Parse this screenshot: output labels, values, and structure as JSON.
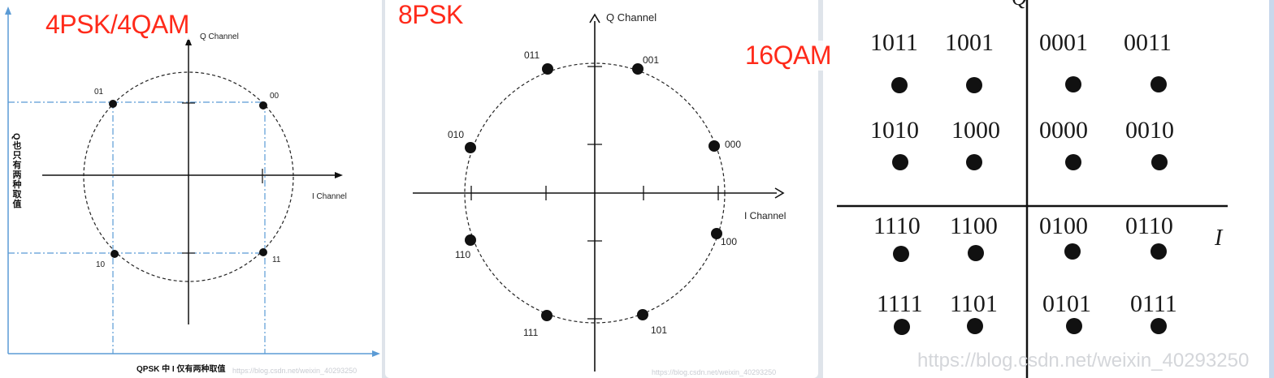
{
  "panels": {
    "qpsk": {
      "title": "4PSK/4QAM",
      "q_axis": "Q Channel",
      "i_axis": "I Channel",
      "left_note": "Q也只有两种取值",
      "bottom_note": "QPSK 中 I 仅有两种取值",
      "watermark": "https://blog.csdn.net/weixin_40293250",
      "points": [
        "01",
        "00",
        "10",
        "11"
      ]
    },
    "psk8": {
      "title": "8PSK",
      "q_axis": "Q Channel",
      "i_axis": "I Channel",
      "watermark": "https://blog.csdn.net/weixin_40293250",
      "points": [
        "000",
        "001",
        "011",
        "010",
        "110",
        "111",
        "101",
        "100"
      ]
    },
    "qam16": {
      "title": "16QAM",
      "i_label": "I",
      "q_label": "Q",
      "watermark": "https://blog.csdn.net/weixin_40293250",
      "labels": [
        [
          "1011",
          "1001",
          "0001",
          "0011"
        ],
        [
          "1010",
          "1000",
          "0000",
          "0010"
        ],
        [
          "1110",
          "1100",
          "0100",
          "0110"
        ],
        [
          "1111",
          "1101",
          "0101",
          "0111"
        ]
      ]
    }
  },
  "colors": {
    "title_red": "#ff2a1a",
    "guide_blue": "#5b9bd5",
    "ink": "#111111"
  }
}
